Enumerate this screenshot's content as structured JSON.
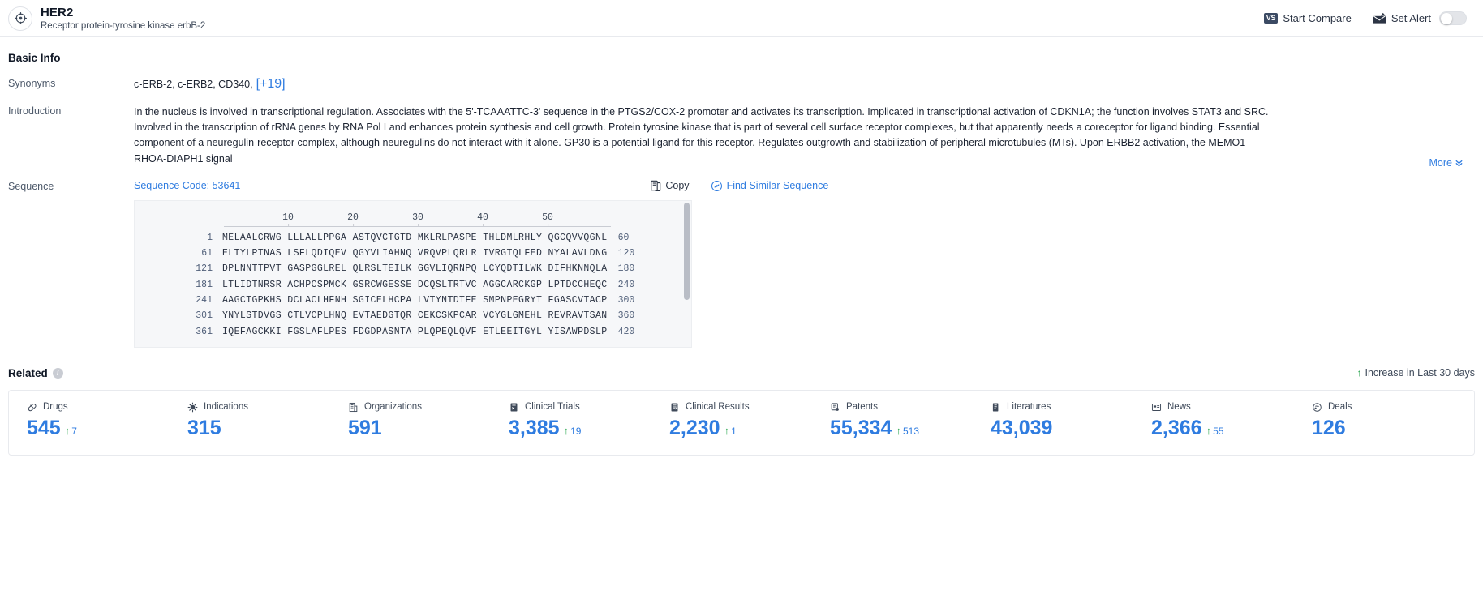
{
  "header": {
    "logo_icon": "target-crosshair-icon",
    "title": "HER2",
    "subtitle": "Receptor protein-tyrosine kinase erbB-2",
    "start_compare_label": "Start Compare",
    "vs_badge": "VS",
    "set_alert_label": "Set Alert",
    "alert_toggle_state": "off"
  },
  "basic_info": {
    "section_title": "Basic Info",
    "synonyms_label": "Synonyms",
    "synonyms_value": "c-ERB-2,  c-ERB2,  CD340,",
    "synonyms_more": "[+19]",
    "introduction_label": "Introduction",
    "introduction_text": "In the nucleus is involved in transcriptional regulation. Associates with the 5'-TCAAATTC-3' sequence in the PTGS2/COX-2 promoter and activates its transcription. Implicated in transcriptional activation of CDKN1A; the function involves STAT3 and SRC. Involved in the transcription of rRNA genes by RNA Pol I and enhances protein synthesis and cell growth. Protein tyrosine kinase that is part of several cell surface receptor complexes, but that apparently needs a coreceptor for ligand binding. Essential component of a neuregulin-receptor complex, although neuregulins do not interact with it alone. GP30 is a potential ligand for this receptor. Regulates outgrowth and stabilization of peripheral microtubules (MTs). Upon ERBB2 activation, the MEMO1-RHOA-DIAPH1 signal",
    "more_label": "More"
  },
  "sequence": {
    "label": "Sequence",
    "code_label": "Sequence Code: 53641",
    "copy_label": "Copy",
    "find_similar_label": "Find Similar Sequence",
    "ruler": [
      "10",
      "20",
      "30",
      "40",
      "50"
    ],
    "rows": [
      {
        "start": "1",
        "blocks": "MELAALCRWG LLLALLPPGA ASTQVCTGTD MKLRLPASPE THLDMLRHLY QGCQVVQGNL",
        "end": "60"
      },
      {
        "start": "61",
        "blocks": "ELTYLPTNAS LSFLQDIQEV QGYVLIAHNQ VRQVPLQRLR IVRGTQLFED NYALAVLDNG",
        "end": "120"
      },
      {
        "start": "121",
        "blocks": "DPLNNTTPVT GASPGGLREL QLRSLTEILK GGVLIQRNPQ LCYQDTILWK DIFHKNNQLA",
        "end": "180"
      },
      {
        "start": "181",
        "blocks": "LTLIDTNRSR ACHPCSPMCK GSRCWGESSE DCQSLTRTVC AGGCARCKGP LPTDCCHEQC",
        "end": "240"
      },
      {
        "start": "241",
        "blocks": "AAGCTGPKHS DCLACLHFNH SGICELHCPA LVTYNTDTFE SMPNPEGRYT FGASCVTACP",
        "end": "300"
      },
      {
        "start": "301",
        "blocks": "YNYLSTDVGS CTLVCPLHNQ EVTAEDGTQR CEKCSKPCAR VCYGLGMEHL REVRAVTSAN",
        "end": "360"
      },
      {
        "start": "361",
        "blocks": "IQEFAGCKKI FGSLAFLPES FDGDPASNTA PLQPEQLQVF ETLEEITGYL YISAWPDSLP",
        "end": "420"
      }
    ]
  },
  "related": {
    "section_title": "Related",
    "increase_note": "Increase in Last 30 days",
    "cards": [
      {
        "icon": "pill-icon",
        "label": "Drugs",
        "value": "545",
        "delta": "7"
      },
      {
        "icon": "virus-icon",
        "label": "Indications",
        "value": "315",
        "delta": ""
      },
      {
        "icon": "building-icon",
        "label": "Organizations",
        "value": "591",
        "delta": ""
      },
      {
        "icon": "clipboard-trial-icon",
        "label": "Clinical Trials",
        "value": "3,385",
        "delta": "19"
      },
      {
        "icon": "results-doc-icon",
        "label": "Clinical Results",
        "value": "2,230",
        "delta": "1"
      },
      {
        "icon": "patent-icon",
        "label": "Patents",
        "value": "55,334",
        "delta": "513"
      },
      {
        "icon": "book-icon",
        "label": "Literatures",
        "value": "43,039",
        "delta": ""
      },
      {
        "icon": "news-icon",
        "label": "News",
        "value": "2,366",
        "delta": "55"
      },
      {
        "icon": "deals-icon",
        "label": "Deals",
        "value": "126",
        "delta": ""
      }
    ]
  },
  "colors": {
    "accent_blue": "#2f7ce0",
    "delta_green": "#22a349",
    "text_dark": "#1c2331",
    "panel_bg": "#f6f7f9"
  }
}
